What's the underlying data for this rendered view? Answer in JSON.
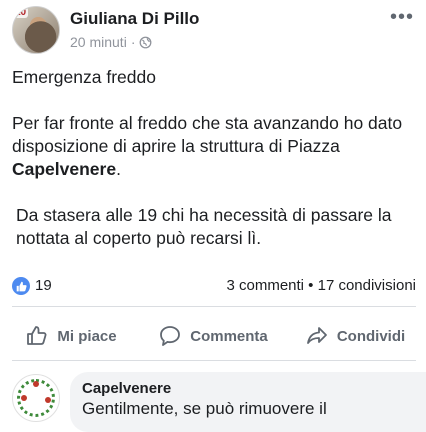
{
  "post": {
    "author": "Giuliana Di Pillo",
    "avatar_badge": "10",
    "time": "20 minuti",
    "separator": "·",
    "privacy_icon": "globe-icon",
    "more_icon": "more-dots-icon",
    "paragraphs": [
      "Emergenza freddo",
      "Per far fronte al freddo che sta avanzando ho dato disposizione di aprire la struttura di Piazza ",
      "Da stasera alle 19 chi ha necessità di passare la nottata al coperto può recarsi lì."
    ],
    "bold_place": "Capelvenere",
    "after_place": "."
  },
  "reactions": {
    "like_count": "19",
    "stats": "3 commenti • 17 condivisioni",
    "color": "#4d8af0"
  },
  "actions": {
    "like": "Mi piace",
    "comment": "Commenta",
    "share": "Condividi"
  },
  "comment": {
    "author": "Capelvenere",
    "text": "Gentilmente, se può rimuovere il"
  }
}
